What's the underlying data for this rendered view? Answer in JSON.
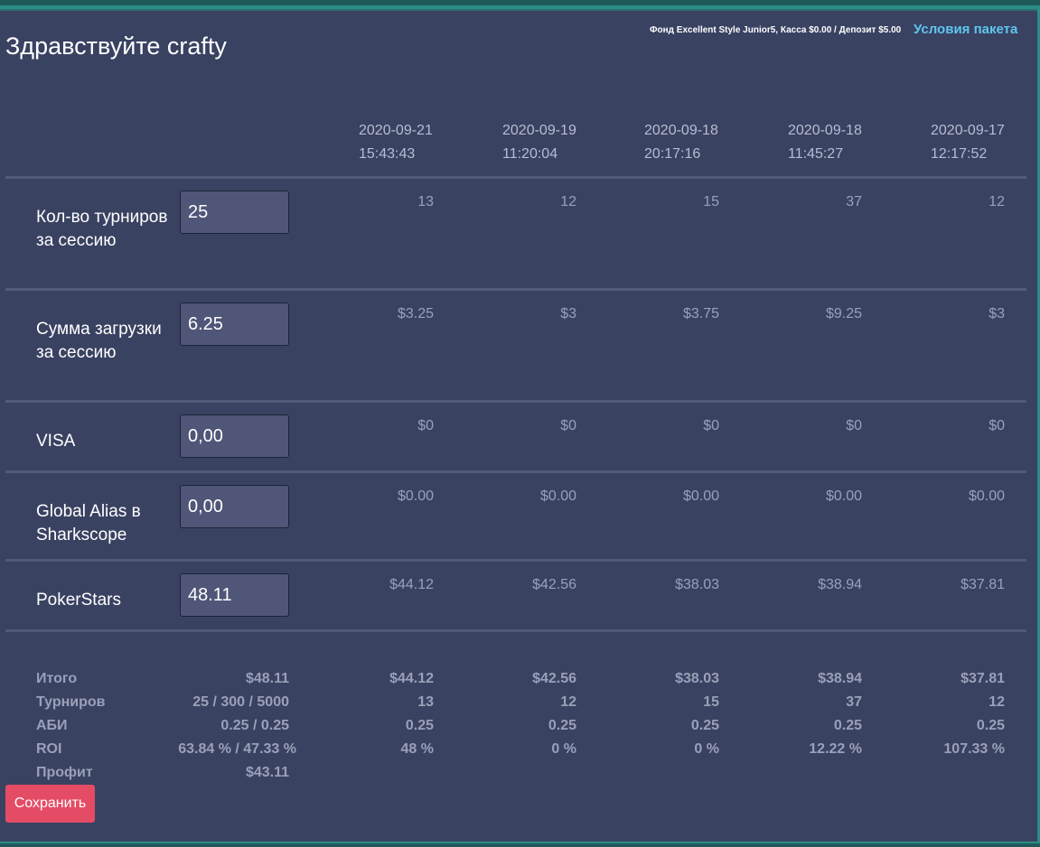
{
  "header": {
    "greeting": "Здравствуйте crafty",
    "fund_info": "Фонд Excellent Style Junior5, Касса $0.00 / Депозит $5.00",
    "terms_link": "Условия пакета"
  },
  "columns": [
    {
      "date": "2020-09-21",
      "time": "15:43:43"
    },
    {
      "date": "2020-09-19",
      "time": "11:20:04"
    },
    {
      "date": "2020-09-18",
      "time": "20:17:16"
    },
    {
      "date": "2020-09-18",
      "time": "11:45:27"
    },
    {
      "date": "2020-09-17",
      "time": "12:17:52"
    }
  ],
  "rows": [
    {
      "label": "Кол-во турниров за сессию",
      "input": "25",
      "values": [
        "13",
        "12",
        "15",
        "37",
        "12"
      ]
    },
    {
      "label": "Сумма загрузки за сессию",
      "input": "6.25",
      "values": [
        "$3.25",
        "$3",
        "$3.75",
        "$9.25",
        "$3"
      ]
    },
    {
      "label": "VISA",
      "input": "0,00",
      "values": [
        "$0",
        "$0",
        "$0",
        "$0",
        "$0"
      ]
    },
    {
      "label": "Global Alias в Sharkscope",
      "input": "0,00",
      "values": [
        "$0.00",
        "$0.00",
        "$0.00",
        "$0.00",
        "$0.00"
      ]
    },
    {
      "label": "PokerStars",
      "input": "48.11",
      "values": [
        "$44.12",
        "$42.56",
        "$38.03",
        "$38.94",
        "$37.81"
      ]
    }
  ],
  "summary": [
    {
      "label": "Итого",
      "current": "$48.11",
      "values": [
        "$44.12",
        "$42.56",
        "$38.03",
        "$38.94",
        "$37.81"
      ]
    },
    {
      "label": "Турниров",
      "current": "25 / 300 / 5000",
      "values": [
        "13",
        "12",
        "15",
        "37",
        "12"
      ]
    },
    {
      "label": "АБИ",
      "current": "0.25 / 0.25",
      "values": [
        "0.25",
        "0.25",
        "0.25",
        "0.25",
        "0.25"
      ]
    },
    {
      "label": "ROI",
      "current": "63.84 % / 47.33 %",
      "values": [
        "48 %",
        "0 %",
        "0 %",
        "12.22 %",
        "107.33 %"
      ]
    },
    {
      "label": "Профит",
      "current": "$43.11",
      "values": [
        "",
        "",
        "",
        "",
        ""
      ]
    }
  ],
  "actions": {
    "save_label": "Сохранить"
  },
  "colors": {
    "background": "#3a4262",
    "accent_link": "#5fc6ef",
    "save_button": "#e44c65"
  }
}
